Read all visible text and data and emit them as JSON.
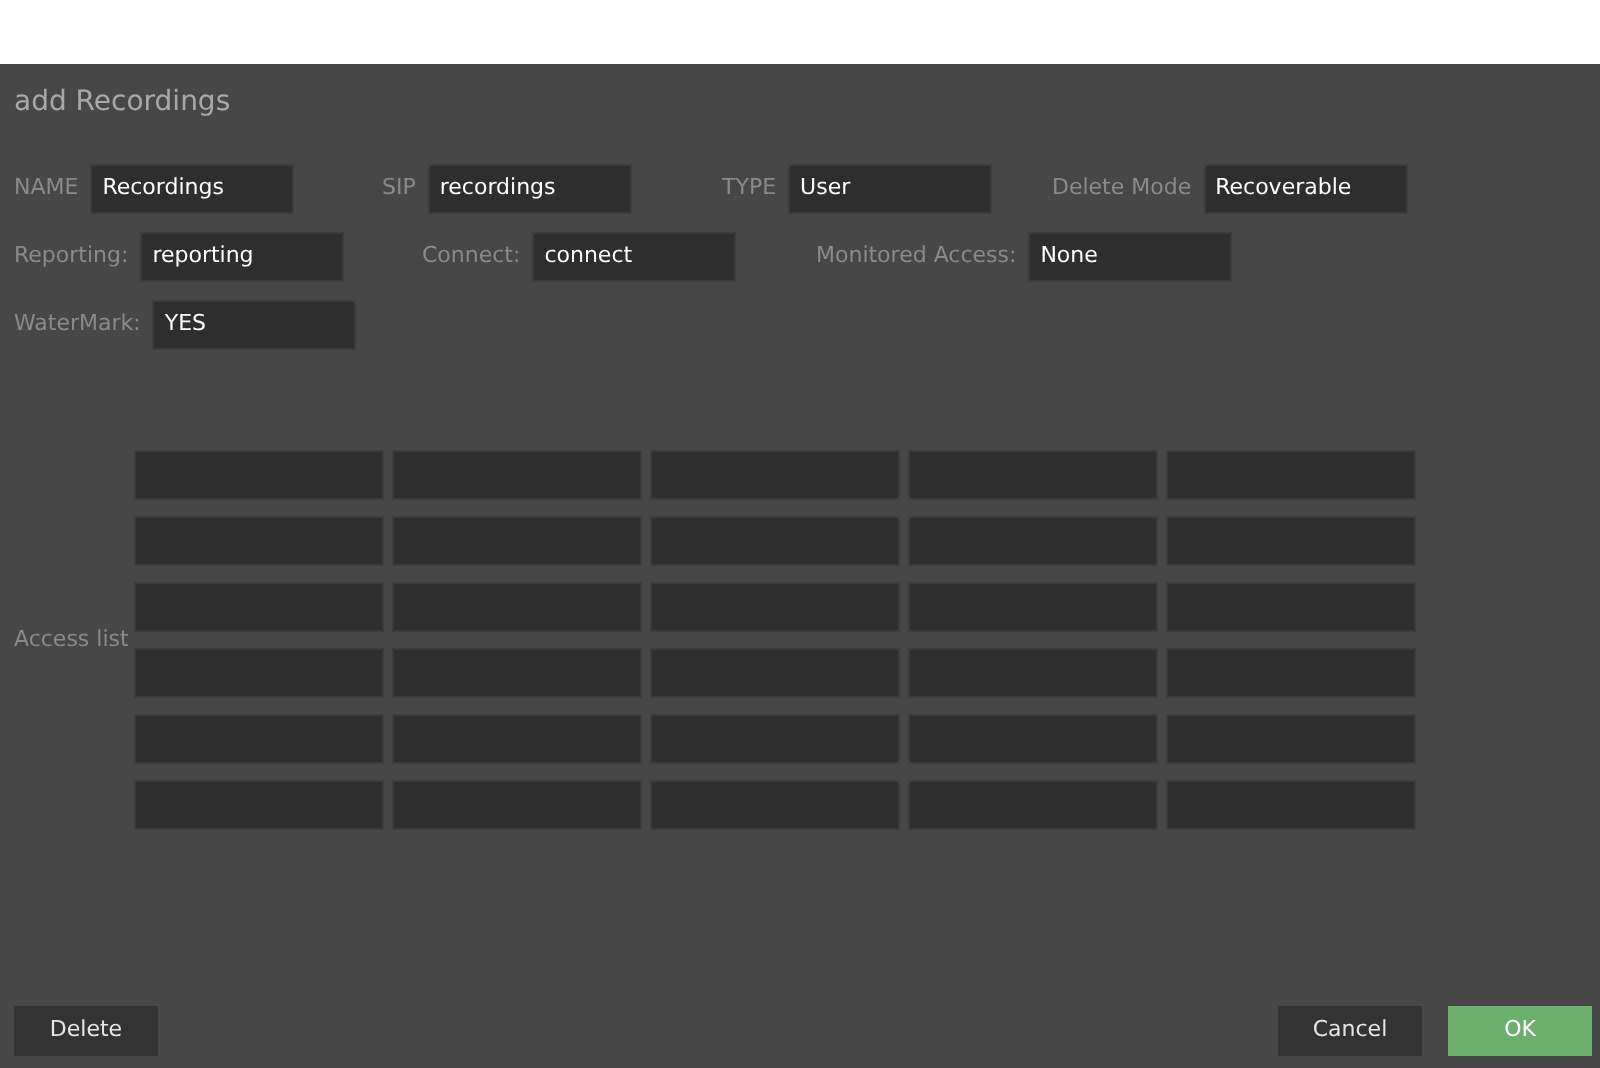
{
  "dialog": {
    "title": "add Recordings"
  },
  "field_rows": [
    {
      "fields": [
        {
          "label": "NAME",
          "value": "Recordings"
        },
        {
          "label": "SIP",
          "value": "recordings"
        },
        {
          "label": "TYPE",
          "value": "User"
        },
        {
          "label": "Delete Mode",
          "value": "Recoverable"
        }
      ]
    },
    {
      "fields": [
        {
          "label": "Reporting:",
          "value": "reporting"
        },
        {
          "label": "Connect:",
          "value": "connect"
        },
        {
          "label": "Monitored Access:",
          "value": "None"
        }
      ]
    },
    {
      "fields": [
        {
          "label": "WaterMark:",
          "value": "YES"
        }
      ]
    }
  ],
  "access_list": {
    "label": "Access list",
    "rows": [
      {
        "cells": [
          {
            "kind": "field"
          },
          {
            "kind": "field"
          },
          {
            "kind": "field"
          },
          {
            "kind": "field"
          },
          {
            "kind": "field"
          }
        ]
      },
      {
        "cells": [
          {
            "kind": "field"
          },
          {
            "kind": "field"
          },
          {
            "kind": "field"
          },
          {
            "kind": "field"
          },
          {
            "kind": "field"
          }
        ]
      },
      {
        "cells": [
          {
            "kind": "field"
          },
          {
            "kind": "field"
          },
          {
            "kind": "field"
          },
          {
            "kind": "field"
          },
          {
            "kind": "field"
          }
        ]
      },
      {
        "cells": [
          {
            "kind": "field"
          },
          {
            "kind": "field"
          },
          {
            "kind": "field"
          },
          {
            "kind": "field"
          },
          {
            "kind": "field"
          }
        ]
      },
      {
        "cells": [
          {
            "kind": "field"
          },
          {
            "kind": "field"
          },
          {
            "kind": "field"
          },
          {
            "kind": "field"
          },
          {
            "kind": "field"
          }
        ]
      },
      {
        "cells": [
          {
            "kind": "field"
          },
          {
            "kind": "field"
          },
          {
            "kind": "field"
          },
          {
            "kind": "field"
          },
          {
            "kind": "field"
          }
        ]
      }
    ]
  },
  "buttons": [
    {
      "label": "Delete",
      "kind": "secondary"
    },
    {
      "label": "Cancel",
      "kind": "secondary"
    },
    {
      "label": "OK",
      "kind": "primary"
    }
  ]
}
